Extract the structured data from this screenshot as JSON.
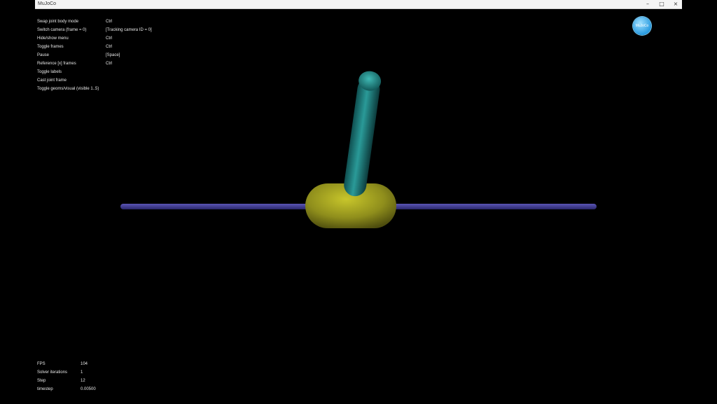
{
  "window": {
    "title": "MuJoCo",
    "controls": {
      "minimize": "–",
      "maximize": "□",
      "close": "×"
    }
  },
  "help_overlay": [
    {
      "key": "Swap joint body mode",
      "value": "Ctrl"
    },
    {
      "key": "Switch camera (frame = 0)",
      "value": "[Tracking camera ID = 0]"
    },
    {
      "key": "Hide/show menu",
      "value": "Ctrl"
    },
    {
      "key": "Toggle frames",
      "value": "Ctrl"
    },
    {
      "key": "Pause",
      "value": "[Space]"
    },
    {
      "key": "Reference [x] frames",
      "value": "Ctrl"
    },
    {
      "key": "Toggle labels",
      "value": ""
    },
    {
      "key": "Cast joint frame",
      "value": ""
    },
    {
      "key": "Toggle geoms/visual (visible 1..5)",
      "value": ""
    }
  ],
  "stats_overlay": [
    {
      "key": "FPS",
      "value": "104"
    },
    {
      "key": "Solver iterations",
      "value": "1"
    },
    {
      "key": "Step",
      "value": "12"
    },
    {
      "key": "timestep",
      "value": "0.00500"
    }
  ],
  "logo": {
    "label": "MuJoCo"
  },
  "scene": {
    "colors": {
      "background": "#000000",
      "rail": "#3f3a8c",
      "cart": "#8f8e1c",
      "pole": "#1f7c7a"
    },
    "objects": [
      "rail",
      "cart",
      "pole"
    ]
  }
}
